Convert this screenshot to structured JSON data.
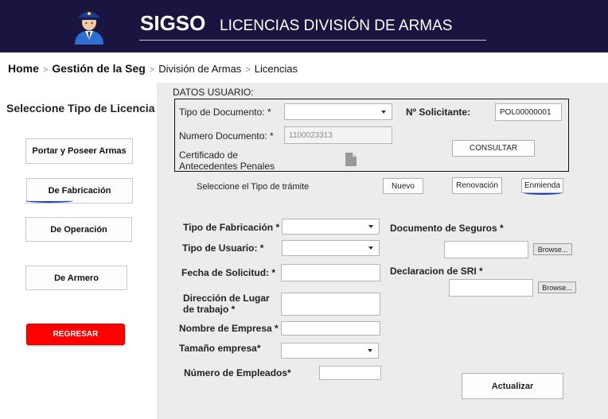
{
  "header": {
    "logo_icon": "police-officer-icon",
    "brand": "SIGSO",
    "subtitle": "LICENCIAS DIVISIÓN DE ARMAS"
  },
  "breadcrumb": {
    "home": "Home",
    "gestion": "Gestión de la Seg",
    "division": "División de Armas",
    "licencias": "Licencias",
    "separator": ">"
  },
  "sidebar": {
    "title": "Seleccione Tipo de Licencia",
    "buttons": {
      "portar": "Portar y Poseer Armas",
      "fabricacion": "De Fabricación",
      "operacion": "De Operación",
      "armero": "De Armero"
    },
    "regresar": "REGRESAR"
  },
  "datos_usuario": {
    "section_title": "DATOS USUARIO:",
    "tipo_documento_label": "Tipo de Documento: *",
    "tipo_documento_value": "",
    "solicitante_label": "Nº Solicitante:",
    "solicitante_value": "POL00000001",
    "numero_documento_label": "Numero Documento: *",
    "numero_documento_value": "1100023313",
    "certificado_label_line1": "Certificado de",
    "certificado_label_line2": "Antecedentes Penales",
    "certificado_icon": "document-icon",
    "consultar": "CONSULTAR"
  },
  "tramite": {
    "label": "Seleccione el Tipo de trámite",
    "nuevo": "Nuevo",
    "renovacion": "Renovación",
    "enmienda": "Enmienda"
  },
  "form": {
    "tipo_fabricacion_label": "Tipo de Fabricación *",
    "tipo_usuario_label": "Tipo de Usuario: *",
    "fecha_solicitud_label": "Fecha de Solicitud: *",
    "direccion_label_line1": "Dirección de Lugar",
    "direccion_label_line2": "de trabajo *",
    "nombre_empresa_label": "Nombre de Empresa *",
    "tamano_empresa_label": "Tamaño empresa*",
    "numero_empleados_label": "Número de Empleados*",
    "documento_seguros_label": "Documento de Seguros *",
    "declaracion_sri_label": "Declaracion de SRI *",
    "browse": "Browse...",
    "actualizar": "Actualizar"
  },
  "colors": {
    "header_bg": "#1a1440",
    "panel_bg": "#ececec",
    "danger": "#ff0000",
    "annotation": "#1b3bd6"
  }
}
